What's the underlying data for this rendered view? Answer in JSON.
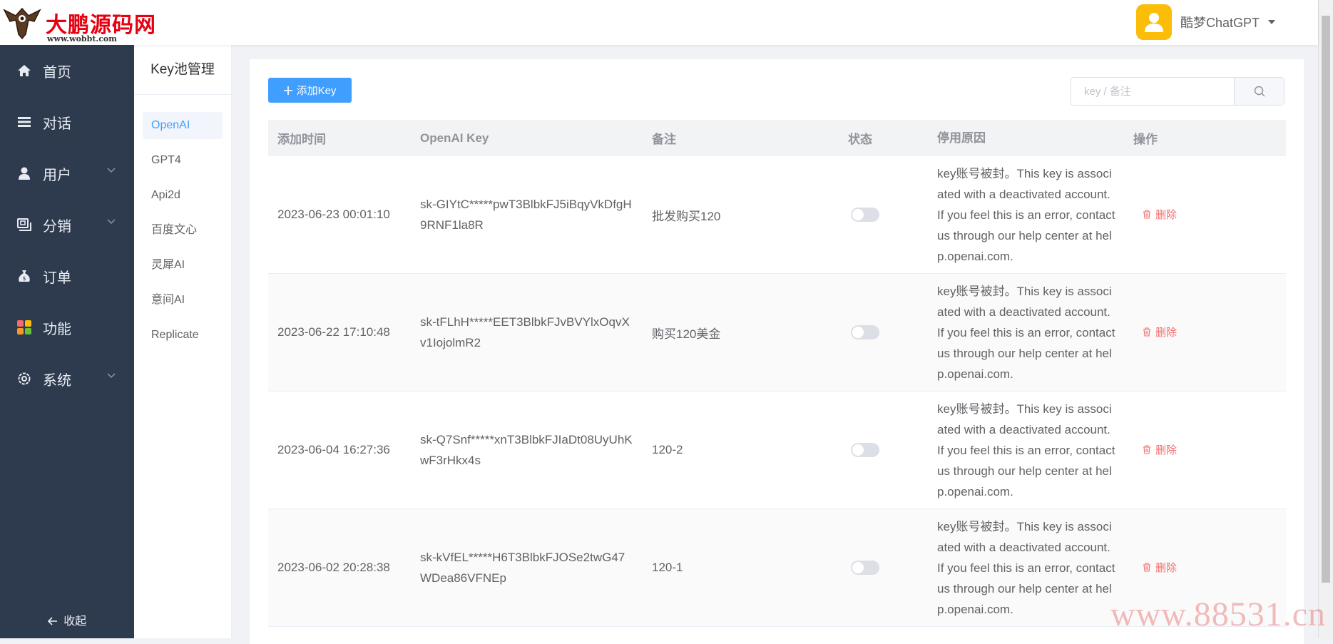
{
  "header": {
    "logo_title": "大鹏源码网",
    "logo_url": "www.wobbt.com",
    "username": "酷梦ChatGPT"
  },
  "sidebar": {
    "items": [
      {
        "label": "首页",
        "icon": "home-icon",
        "has_children": false
      },
      {
        "label": "对话",
        "icon": "menu-icon",
        "has_children": false
      },
      {
        "label": "用户",
        "icon": "user-icon",
        "has_children": true
      },
      {
        "label": "分销",
        "icon": "share-icon",
        "has_children": true
      },
      {
        "label": "订单",
        "icon": "money-bag-icon",
        "has_children": false
      },
      {
        "label": "功能",
        "icon": "apps-icon",
        "has_children": false
      },
      {
        "label": "系统",
        "icon": "settings-icon",
        "has_children": true
      }
    ],
    "collapse_label": "收起"
  },
  "subnav": {
    "title": "Key池管理",
    "items": [
      {
        "label": "OpenAI",
        "active": true
      },
      {
        "label": "GPT4",
        "active": false
      },
      {
        "label": "Api2d",
        "active": false
      },
      {
        "label": "百度文心",
        "active": false
      },
      {
        "label": "灵犀AI",
        "active": false
      },
      {
        "label": "意间AI",
        "active": false
      },
      {
        "label": "Replicate",
        "active": false
      }
    ]
  },
  "toolbar": {
    "add_label": "添加Key",
    "search_placeholder": "key / 备注"
  },
  "table": {
    "headers": [
      "添加时间",
      "OpenAI Key",
      "备注",
      "状态",
      "停用原因",
      "操作"
    ],
    "delete_label": "删除",
    "rows": [
      {
        "time": "2023-06-23 00:01:10",
        "key": "sk-GIYtC*****pwT3BlbkFJ5iBqyVkDfgH9RNF1la8R",
        "note": "批发购买120",
        "enabled": false,
        "reason": "key账号被封。This key is associated with a deactivated account. If you feel this is an error, contact us through our help center at help.openai.com."
      },
      {
        "time": "2023-06-22 17:10:48",
        "key": "sk-tFLhH*****EET3BlbkFJvBVYlxOqvXv1IojolmR2",
        "note": "购买120美金",
        "enabled": false,
        "reason": "key账号被封。This key is associated with a deactivated account. If you feel this is an error, contact us through our help center at help.openai.com."
      },
      {
        "time": "2023-06-04 16:27:36",
        "key": "sk-Q7Snf*****xnT3BlbkFJIaDt08UyUhKwF3rHkx4s",
        "note": "120-2",
        "enabled": false,
        "reason": "key账号被封。This key is associated with a deactivated account. If you feel this is an error, contact us through our help center at help.openai.com."
      },
      {
        "time": "2023-06-02 20:28:38",
        "key": "sk-kVfEL*****H6T3BlbkFJOSe2twG47WDea86VFNEp",
        "note": "120-1",
        "enabled": false,
        "reason": "key账号被封。This key is associated with a deactivated account. If you feel this is an error, contact us through our help center at help.openai.com."
      }
    ]
  },
  "watermark": "www.88531.cn",
  "colors": {
    "primary": "#409eff",
    "sidebar_bg": "#2e3b4e",
    "danger": "#f56c6c",
    "avatar": "#fbbd08",
    "logo_red": "#e60012"
  }
}
